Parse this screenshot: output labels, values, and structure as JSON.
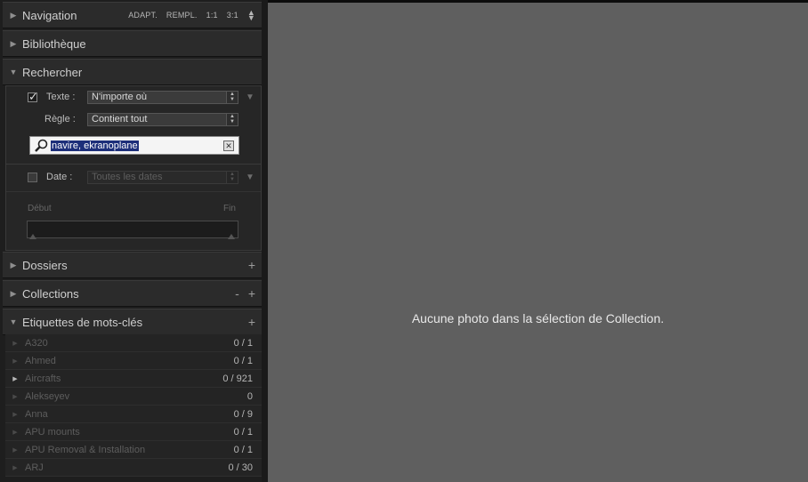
{
  "navigation": {
    "title": "Navigation",
    "options": [
      "ADAPT.",
      "REMPL.",
      "1:1",
      "3:1"
    ]
  },
  "sections": {
    "bibliotheque": "Bibliothèque",
    "rechercher": "Rechercher",
    "dossiers": "Dossiers",
    "collections": "Collections",
    "etiquettes": "Etiquettes de mots-clés"
  },
  "search": {
    "texte_label": "Texte :",
    "texte_value": "N'importe où",
    "regle_label": "Règle :",
    "regle_value": "Contient tout",
    "query": "navire, ekranoplane",
    "date_label": "Date :",
    "date_value": "Toutes les dates",
    "debut": "Début",
    "fin": "Fin"
  },
  "keywords": [
    {
      "name": "A320",
      "count": "0 / 1",
      "expandable": false
    },
    {
      "name": "Ahmed",
      "count": "0 / 1",
      "expandable": false
    },
    {
      "name": "Aircrafts",
      "count": "0 / 921",
      "expandable": true
    },
    {
      "name": "Alekseyev",
      "count": "0",
      "expandable": false
    },
    {
      "name": "Anna",
      "count": "0 / 9",
      "expandable": false
    },
    {
      "name": "APU mounts",
      "count": "0 / 1",
      "expandable": false
    },
    {
      "name": "APU Removal & Installation",
      "count": "0 / 1",
      "expandable": false
    },
    {
      "name": "ARJ",
      "count": "0 / 30",
      "expandable": false
    }
  ],
  "main": {
    "empty_message": "Aucune photo dans la sélection de Collection."
  }
}
